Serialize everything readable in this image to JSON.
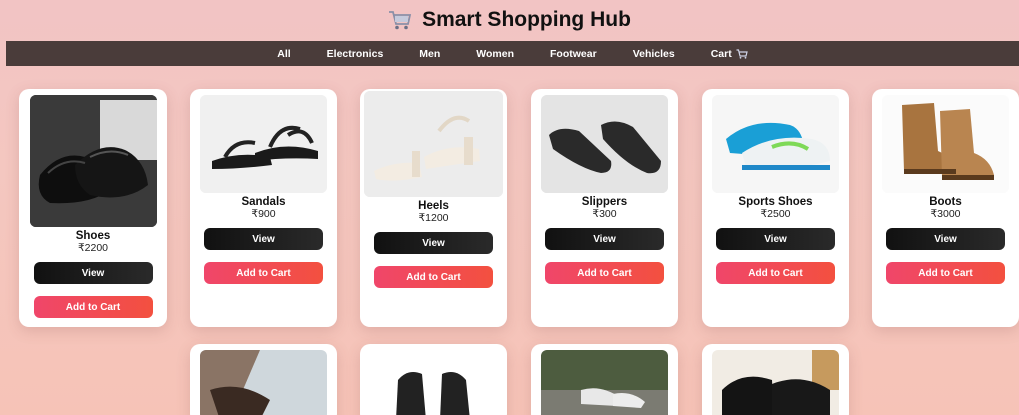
{
  "header": {
    "title": "Smart Shopping Hub",
    "logo_icon": "shopping-cart-icon"
  },
  "nav": {
    "items": [
      "All",
      "Electronics",
      "Men",
      "Women",
      "Footwear",
      "Vehicles",
      "Cart"
    ],
    "cart_icon": "cart-icon"
  },
  "products": [
    {
      "name": "Shoes",
      "price": "₹2200",
      "view_label": "View",
      "cart_label": "Add to Cart",
      "image": "black-formal-shoes"
    },
    {
      "name": "Sandals",
      "price": "₹900",
      "view_label": "View",
      "cart_label": "Add to Cart",
      "image": "black-sandals"
    },
    {
      "name": "Heels",
      "price": "₹1200",
      "view_label": "View",
      "cart_label": "Add to Cart",
      "image": "white-heels"
    },
    {
      "name": "Slippers",
      "price": "₹300",
      "view_label": "View",
      "cart_label": "Add to Cart",
      "image": "black-flip-flops"
    },
    {
      "name": "Sports Shoes",
      "price": "₹2500",
      "view_label": "View",
      "cart_label": "Add to Cart",
      "image": "white-blue-sports-shoes"
    },
    {
      "name": "Boots",
      "price": "₹3000",
      "view_label": "View",
      "cart_label": "Add to Cart",
      "image": "brown-boots"
    }
  ],
  "second_row_images": [
    "loafers-on-rug",
    "black-flip-flops-top",
    "white-sneakers-walking",
    "black-leather-shoes"
  ],
  "colors": {
    "nav_bg": "#4a3c3a",
    "view_button": "#111111",
    "cart_button": "#f0466a",
    "page_bg": "#f3c5be"
  }
}
